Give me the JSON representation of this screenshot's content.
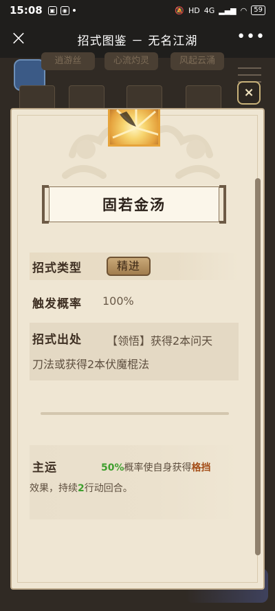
{
  "status_bar": {
    "time": "15:08",
    "network": "4G",
    "battery": "59"
  },
  "nav": {
    "close_label": "×",
    "title": "招式图鉴 － 无名江湖",
    "more_label": "•••"
  },
  "background": {
    "tabs": [
      "逍游丝",
      "心流灼灵",
      "风起云涌"
    ]
  },
  "dialog": {
    "close_label": "×",
    "skill_name": "固若金汤",
    "type": {
      "label": "招式类型",
      "value": "精进"
    },
    "rate": {
      "label": "触发概率",
      "value": "100%"
    },
    "source": {
      "label": "招式出处",
      "line1": "【领悟】获得2本问天",
      "line2": "刀法或获得2本伏魔棍法"
    },
    "effect": {
      "label": "主运",
      "pct": "50%",
      "text_a": "概率使自身获得",
      "keyword": "格挡",
      "text_b": "效果，持续",
      "turns": "2",
      "text_c": "行动回合。"
    }
  },
  "colors": {
    "accent_green": "#3f9f2e",
    "accent_keyword": "#a34c16",
    "dialog_bg": "#efe6d3"
  }
}
